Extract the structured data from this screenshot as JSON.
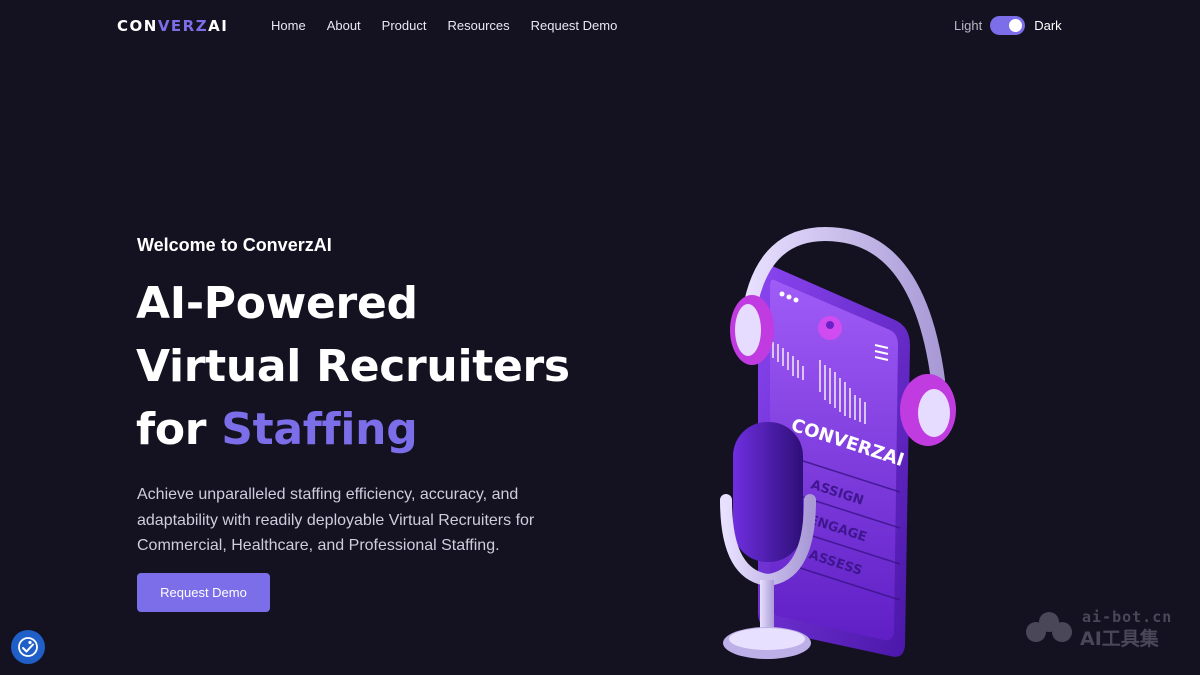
{
  "header": {
    "logo": {
      "part1": "CON",
      "part2": "VERZ",
      "part3": "AI"
    },
    "nav": [
      "Home",
      "About",
      "Product",
      "Resources",
      "Request Demo"
    ],
    "theme_toggle": {
      "light_label": "Light",
      "dark_label": "Dark",
      "state": "dark"
    }
  },
  "hero": {
    "welcome": "Welcome to ConverzAI",
    "headline_line1": "AI-Powered",
    "headline_line2": "Virtual Recruiters",
    "headline_line3_prefix": "for ",
    "headline_highlight": "Staffing",
    "description": "Achieve unparalleled staffing efficiency, accuracy, and adaptability with readily deployable Virtual Recruiters for Commercial, Healthcare, and Professional Staffing.",
    "cta_label": "Request Demo"
  },
  "illustration": {
    "phone_brand": "CONVERZAI",
    "steps": [
      "ASSIGN",
      "ENGAGE",
      "ASSESS"
    ]
  },
  "watermark": {
    "url": "ai-bot.cn",
    "name": "AI工具集"
  },
  "colors": {
    "background": "#141221",
    "accent": "#7b6ee8",
    "accessibility": "#1f5fc7"
  },
  "icons": {
    "accessibility": "accessibility-icon",
    "menu": "hamburger-menu-icon",
    "chat": "chat-bubble-icon"
  }
}
